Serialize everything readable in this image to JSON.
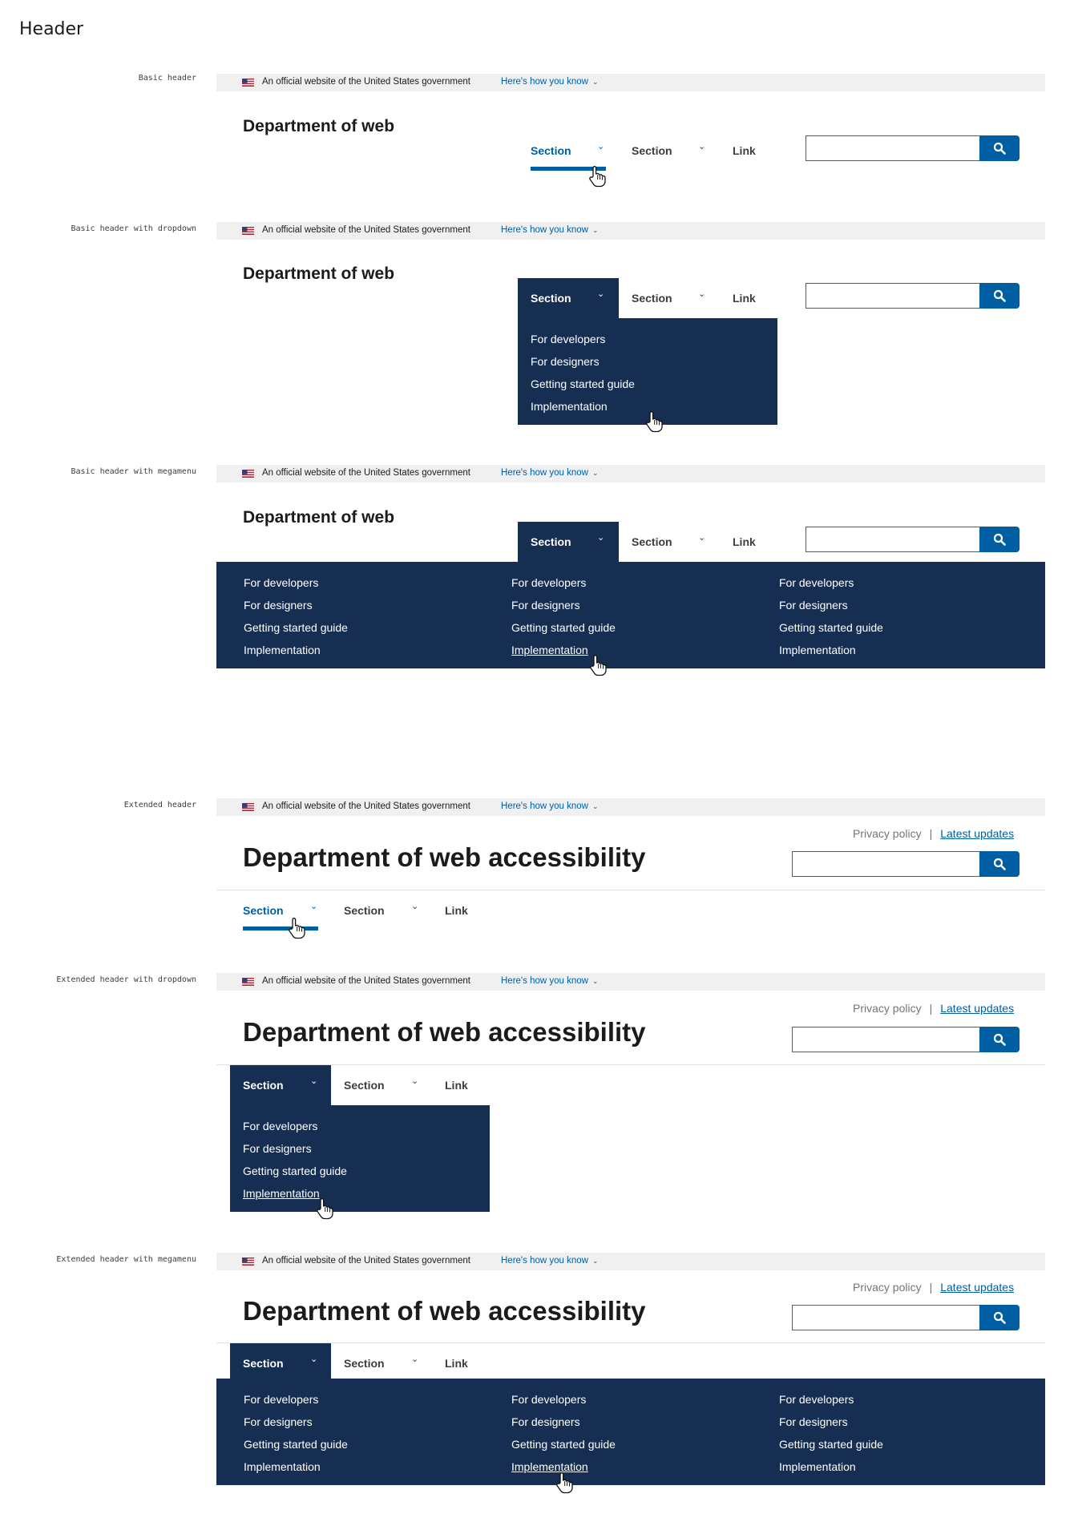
{
  "page": {
    "title": "Header"
  },
  "banner": {
    "official_text": "An official website of the United States government",
    "how_you_know": "Here's how you know"
  },
  "variants": [
    {
      "label": "Basic header",
      "site_title": "Department of web"
    },
    {
      "label": "Basic header with dropdown",
      "site_title": "Department of web"
    },
    {
      "label": "Basic header with megamenu",
      "site_title": "Department of web"
    },
    {
      "label": "Extended header",
      "site_title": "Department of web accessibility"
    },
    {
      "label": "Extended header with dropdown",
      "site_title": "Department of web accessibility"
    },
    {
      "label": "Extended header with megamenu",
      "site_title": "Department of web accessibility"
    }
  ],
  "nav": {
    "section_1": "Section",
    "section_2": "Section",
    "link": "Link"
  },
  "menu_items": [
    "For developers",
    "For designers",
    "Getting started guide",
    "Implementation"
  ],
  "secondary_links": {
    "privacy": "Privacy policy",
    "separator": "|",
    "updates": "Latest updates"
  },
  "colors": {
    "primary": "#005ea2",
    "primary_darker": "#162e51",
    "banner_bg": "#f0f0f0",
    "base_dark": "#1b1b1b"
  },
  "icons": {
    "search": "search-icon",
    "chevron": "chevron-down-icon",
    "flag": "us-flag-icon",
    "cursor": "hand-cursor-icon"
  }
}
